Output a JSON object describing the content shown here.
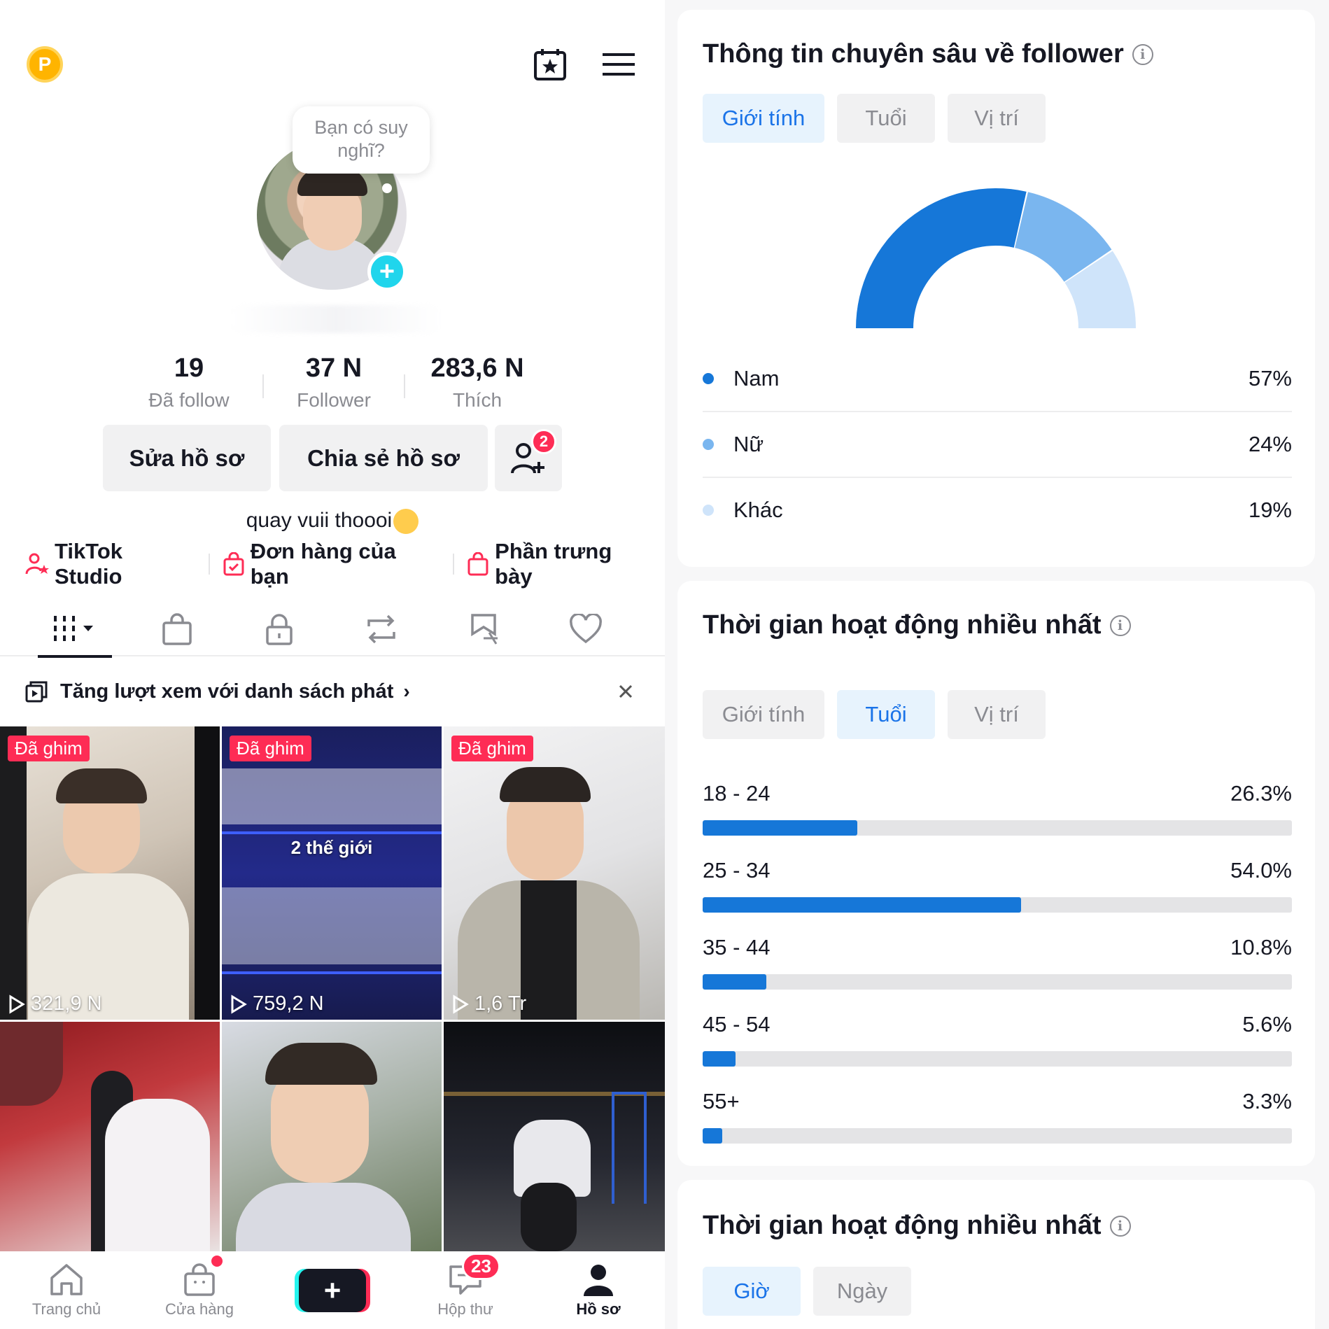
{
  "profile": {
    "coin_label": "P",
    "bubble_text": "Bạn có suy nghĩ?",
    "stats": [
      {
        "value": "19",
        "label": "Đã follow"
      },
      {
        "value": "37 N",
        "label": "Follower"
      },
      {
        "value": "283,6 N",
        "label": "Thích"
      }
    ],
    "edit_label": "Sửa hồ sơ",
    "share_label": "Chia sẻ hồ sơ",
    "friend_badge": "2",
    "bio": "quay vuii thoooi",
    "links": [
      {
        "label": "TikTok Studio",
        "icon": "creator-icon"
      },
      {
        "label": "Đơn hàng của bạn",
        "icon": "order-bag-icon"
      },
      {
        "label": "Phần trưng bày",
        "icon": "showcase-bag-icon"
      }
    ],
    "tabs": [
      "videos-grid-icon",
      "shop-bag-icon",
      "lock-icon",
      "repost-icon",
      "favorites-icon",
      "liked-heart-icon"
    ],
    "promo": "Tăng lượt xem với danh sách phát",
    "videos": [
      {
        "pinned": "Đã ghim",
        "views": "321,9 N"
      },
      {
        "pinned": "Đã ghim",
        "views": "759,2 N",
        "caption": "2 thế giới"
      },
      {
        "pinned": "Đã ghim",
        "views": "1,6 Tr"
      }
    ]
  },
  "nav": {
    "home": "Trang chủ",
    "shop": "Cửa hàng",
    "inbox": "Hộp thư",
    "inbox_count": "23",
    "profile": "Hồ sơ"
  },
  "insights": {
    "title": "Thông tin chuyên sâu về follower",
    "tabs": [
      "Giới tính",
      "Tuổi",
      "Vị trí"
    ],
    "gender": [
      {
        "label": "Nam",
        "value": "57%",
        "color": "#1677d8"
      },
      {
        "label": "Nữ",
        "value": "24%",
        "color": "#7ab6ef"
      },
      {
        "label": "Khác",
        "value": "19%",
        "color": "#cfe4fa"
      }
    ]
  },
  "activity": {
    "title": "Thời gian hoạt động nhiều nhất",
    "tabs": [
      "Giới tính",
      "Tuổi",
      "Vị trí"
    ],
    "ages": [
      {
        "range": "18 - 24",
        "pct": "26.3%",
        "fraction": 0.263
      },
      {
        "range": "25 - 34",
        "pct": "54.0%",
        "fraction": 0.54
      },
      {
        "range": "35 - 44",
        "pct": "10.8%",
        "fraction": 0.108
      },
      {
        "range": "45 - 54",
        "pct": "5.6%",
        "fraction": 0.056
      },
      {
        "range": "55+",
        "pct": "3.3%",
        "fraction": 0.033
      }
    ]
  },
  "activity2": {
    "title": "Thời gian hoạt động nhiều nhất",
    "tabs": [
      "Giờ",
      "Ngày"
    ]
  },
  "chart_data": {
    "type": "pie",
    "categories": [
      "Nam",
      "Nữ",
      "Khác"
    ],
    "values": [
      57,
      24,
      19
    ]
  }
}
